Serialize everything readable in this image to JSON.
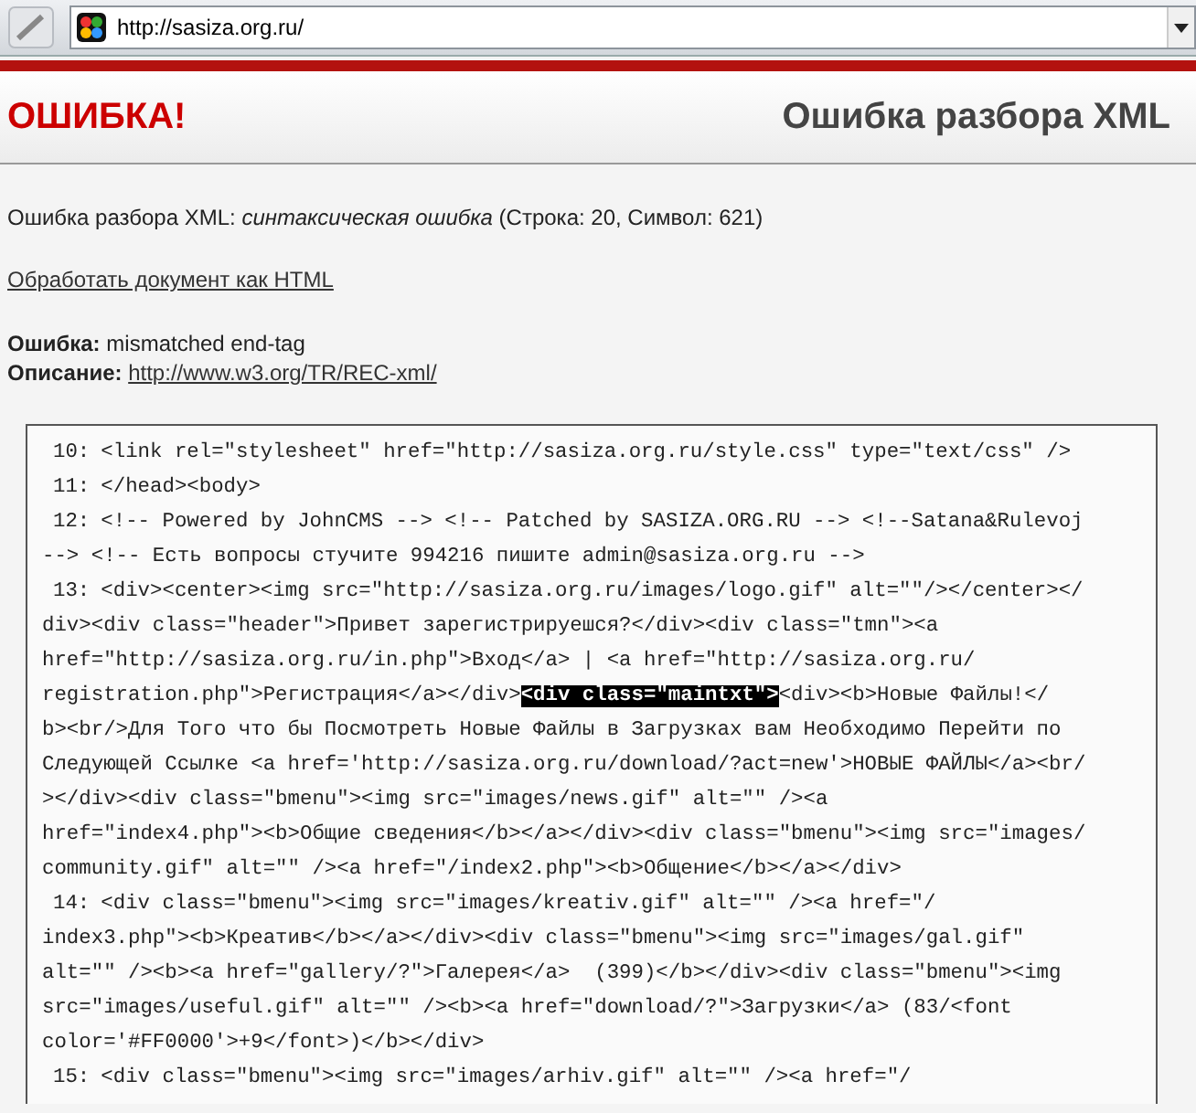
{
  "browser": {
    "address": "http://sasiza.org.ru/"
  },
  "header": {
    "title": "ОШИБКА!",
    "subtitle": "Ошибка разбора XML"
  },
  "message": "Ошибка разбора XML: *синтаксическая ошибка* (Строка: 20, Символ: 621)",
  "html_link": "Обработать документ как HTML",
  "details": [
    {
      "label": "Ошибка:",
      "value": "mismatched end-tag",
      "kind": "text"
    },
    {
      "label": "Описание:",
      "value": "http://www.w3.org/TR/REC-xml/",
      "kind": "link"
    }
  ],
  "source_rows": [
    {
      "number": "10:",
      "segments": [
        {
          "text": "<link rel=\"stylesheet\" href=\"http://sasiza.org.ru/style.css\" type=\"text/css\" />",
          "highlighted": false
        }
      ]
    },
    {
      "number": "11:",
      "segments": [
        {
          "text": "</head><body>",
          "highlighted": false
        }
      ]
    },
    {
      "number": "12:",
      "segments": [
        {
          "text": "<!-- Powered by JohnCMS --> <!-- Patched by SASIZA.ORG.RU --> <!--Satana&Rulevoj",
          "highlighted": false
        }
      ]
    },
    {
      "segments": [
        {
          "text": "--> <!-- Есть вопросы стучите 994216 пишите admin@sasiza.org.ru -->",
          "highlighted": false
        }
      ]
    },
    {
      "number": "13:",
      "segments": [
        {
          "text": "<div><center><img src=\"http://sasiza.org.ru/images/logo.gif\" alt=\"\"/></center></",
          "highlighted": false
        }
      ]
    },
    {
      "segments": [
        {
          "text": "div><div class=\"header\">Привет зарегистрируешся?</div><div class=\"tmn\"><a",
          "highlighted": false
        }
      ]
    },
    {
      "segments": [
        {
          "text": "href=\"http://sasiza.org.ru/in.php\">Вход</a> | <a href=\"http://sasiza.org.ru/",
          "highlighted": false
        }
      ]
    },
    {
      "segments": [
        {
          "text": "registration.php\">Регистрация</a></div>",
          "highlighted": false
        },
        {
          "text": "<div class=\"maintxt\">",
          "highlighted": true
        },
        {
          "text": "<div><b>Новые Файлы!</",
          "highlighted": false
        }
      ]
    },
    {
      "segments": [
        {
          "text": "b><br/>Для Того что бы Посмотреть Новые Файлы в Загрузках вам Необходимо Перейти по",
          "highlighted": false
        }
      ]
    },
    {
      "segments": [
        {
          "text": "Следующей Ссылке <a href='http://sasiza.org.ru/download/?act=new'>НОВЫЕ ФАЙЛЫ</a><br/",
          "highlighted": false
        }
      ]
    },
    {
      "segments": [
        {
          "text": "></div><div class=\"bmenu\"><img src=\"images/news.gif\" alt=\"\" /><a",
          "highlighted": false
        }
      ]
    },
    {
      "segments": [
        {
          "text": "href=\"index4.php\"><b>Общие сведения</b></a></div><div class=\"bmenu\"><img src=\"images/",
          "highlighted": false
        }
      ]
    },
    {
      "segments": [
        {
          "text": "community.gif\" alt=\"\" /><a href=\"/index2.php\"><b>Общение</b></a></div>",
          "highlighted": false
        }
      ]
    },
    {
      "number": "14:",
      "segments": [
        {
          "text": "<div class=\"bmenu\"><img src=\"images/kreativ.gif\" alt=\"\" /><a href=\"/",
          "highlighted": false
        }
      ]
    },
    {
      "segments": [
        {
          "text": "index3.php\"><b>Креатив</b></a></div><div class=\"bmenu\"><img src=\"images/gal.gif\"",
          "highlighted": false
        }
      ]
    },
    {
      "segments": [
        {
          "text": "alt=\"\" /><b><a href=\"gallery/?\">Галерея</a>  (399)</b></div><div class=\"bmenu\"><img",
          "highlighted": false
        }
      ]
    },
    {
      "segments": [
        {
          "text": "src=\"images/useful.gif\" alt=\"\" /><b><a href=\"download/?\">Загрузки</a> (83/<font",
          "highlighted": false
        }
      ]
    },
    {
      "segments": [
        {
          "text": "color='#FF0000'>+9</font>)</b></div>",
          "highlighted": false
        }
      ]
    },
    {
      "number": "15:",
      "segments": [
        {
          "text": "<div class=\"bmenu\"><img src=\"images/arhiv.gif\" alt=\"\" /><a href=\"/",
          "highlighted": false
        }
      ]
    }
  ]
}
